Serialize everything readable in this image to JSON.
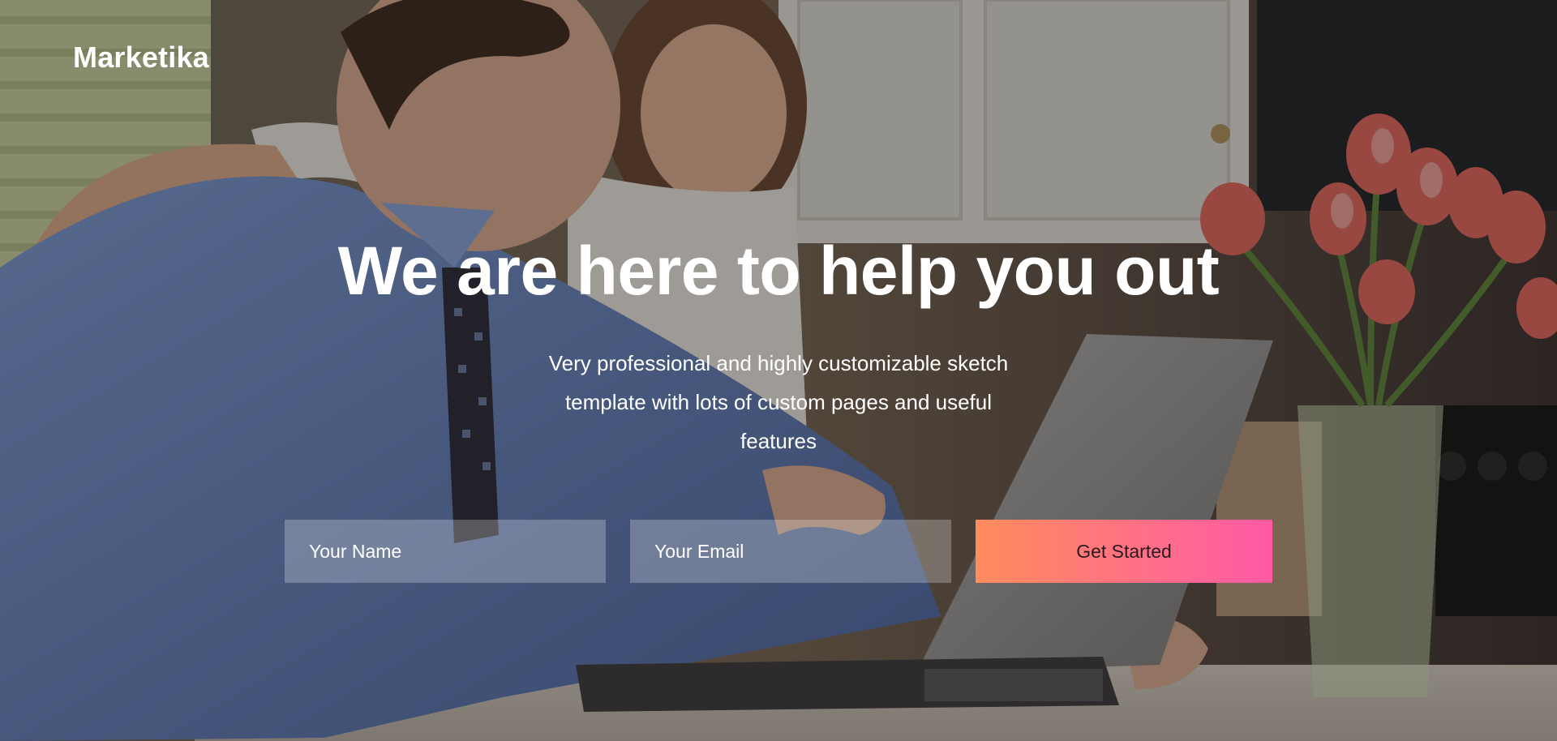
{
  "brand": {
    "name": "Marketika"
  },
  "hero": {
    "headline": "We are here to help you out",
    "subtitle": "Very professional and highly customizable sketch template with lots of custom pages and useful features"
  },
  "form": {
    "name_placeholder": "Your Name",
    "email_placeholder": "Your Email",
    "submit_label": "Get Started"
  },
  "colors": {
    "cta_gradient_start": "#ff8c5e",
    "cta_gradient_end": "#ff5aa5",
    "text": "#ffffff"
  }
}
